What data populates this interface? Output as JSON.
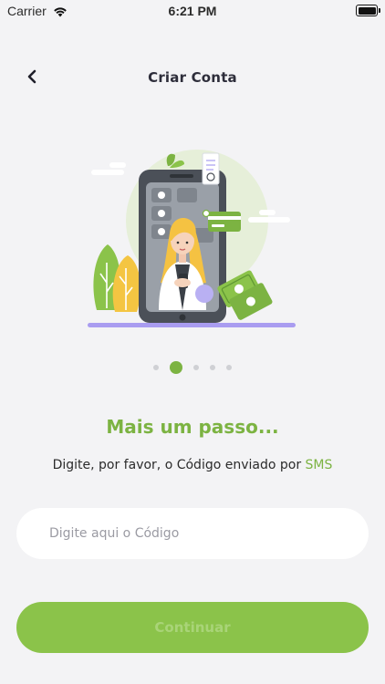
{
  "status_bar": {
    "carrier": "Carrier",
    "time": "6:21 PM",
    "icons": [
      "wifi-icon",
      "battery-icon"
    ]
  },
  "nav": {
    "title": "Criar Conta",
    "back_icon": "chevron-left-icon"
  },
  "illustration": {
    "subject": "woman holding phone inside smartphone with money and card",
    "colors": {
      "primary": "#7cb342",
      "phone": "#4b5058",
      "hair": "#f5c242",
      "accent": "#9b8cf2"
    }
  },
  "pagination": {
    "total": 5,
    "current": 2
  },
  "content": {
    "heading": "Mais um passo...",
    "subtitle_prefix": "Digite, por favor, o Código enviado por ",
    "subtitle_highlight": "SMS"
  },
  "code_input": {
    "placeholder": "Digite aqui o Código",
    "value": ""
  },
  "continue_button": {
    "label": "Continuar",
    "enabled": false
  },
  "colors": {
    "accent": "#7cb342",
    "button_bg": "#8bc34a",
    "button_text_disabled": "#a9d478",
    "background": "#f3f3f5"
  }
}
